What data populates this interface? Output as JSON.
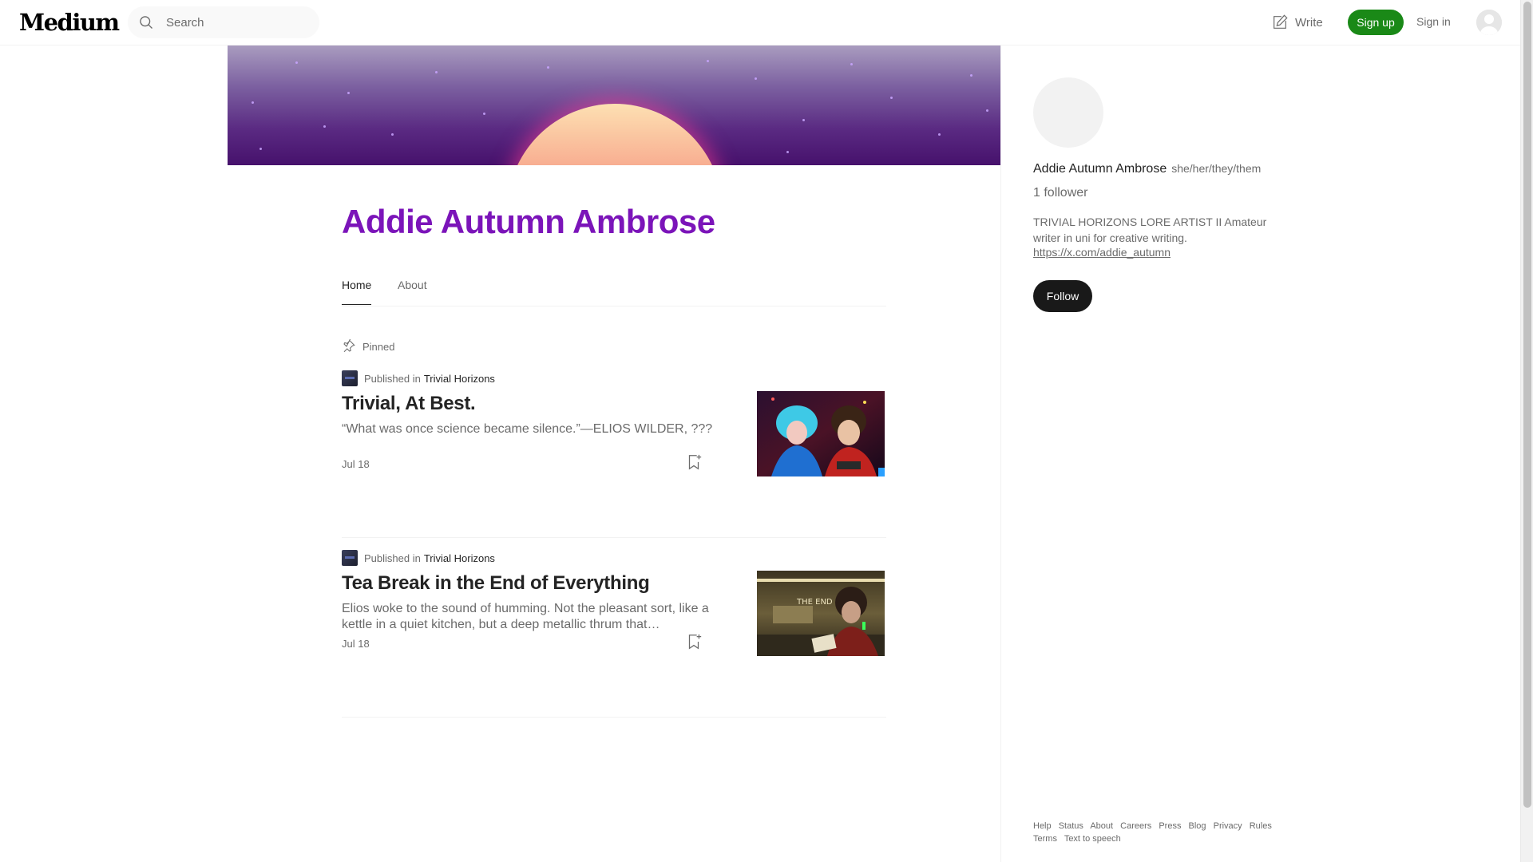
{
  "topbar": {
    "logo": "Medium",
    "search_placeholder": "Search",
    "write_label": "Write",
    "signup_label": "Sign up",
    "signin_label": "Sign in"
  },
  "profile": {
    "name": "Addie Autumn Ambrose",
    "tabs": [
      {
        "label": "Home",
        "active": true
      },
      {
        "label": "About",
        "active": false
      }
    ],
    "pinned_label": "Pinned"
  },
  "articles": [
    {
      "published_prefix": "Published in",
      "publication": "Trivial Horizons",
      "title": "Trivial, At Best.",
      "subtitle": "“What was once science became silence.”—ELIOS WILDER, ???",
      "date": "Jul 18"
    },
    {
      "published_prefix": "Published in",
      "publication": "Trivial Horizons",
      "title": "Tea Break in the End of Everything",
      "subtitle": "Elios woke to the sound of humming. Not the pleasant sort, like a kettle in a quiet kitchen, but a deep metallic thrum that…",
      "date": "Jul 18",
      "thumbnail_text": "THE END"
    }
  ],
  "sidebar": {
    "name": "Addie Autumn Ambrose",
    "pronouns": "she/her/they/them",
    "followers": "1 follower",
    "bio": "TRIVIAL HORIZONS LORE ARTIST II Amateur writer in uni for creative writing.",
    "link": "https://x.com/addie_autumn",
    "follow_label": "Follow",
    "footer_links": [
      "Help",
      "Status",
      "About",
      "Careers",
      "Press",
      "Blog",
      "Privacy",
      "Rules",
      "Terms",
      "Text to speech"
    ]
  },
  "colors": {
    "accent_name": "#7b14b9",
    "signup_green": "#1a8917",
    "follow_black": "#191919"
  }
}
